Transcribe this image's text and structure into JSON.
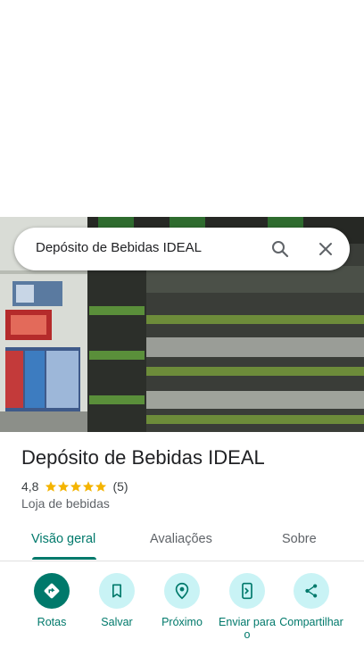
{
  "search": {
    "query": "Depósito de Bebidas IDEAL"
  },
  "place": {
    "name": "Depósito de Bebidas IDEAL",
    "rating": "4,8",
    "stars": 5,
    "review_count": "(5)",
    "category": "Loja de bebidas"
  },
  "tabs": [
    {
      "label": "Visão geral",
      "active": true
    },
    {
      "label": "Avaliações",
      "active": false
    },
    {
      "label": "Sobre",
      "active": false
    }
  ],
  "actions": [
    {
      "label": "Rotas",
      "icon": "directions-icon"
    },
    {
      "label": "Salvar",
      "icon": "bookmark-icon"
    },
    {
      "label": "Próximo",
      "icon": "nearby-icon"
    },
    {
      "label": "Enviar para o",
      "icon": "send-to-phone-icon"
    },
    {
      "label": "Compartilhar",
      "icon": "share-icon"
    }
  ],
  "colors": {
    "accent": "#00796b",
    "action_bg": "#c9f3f5",
    "star": "#f4b400"
  }
}
